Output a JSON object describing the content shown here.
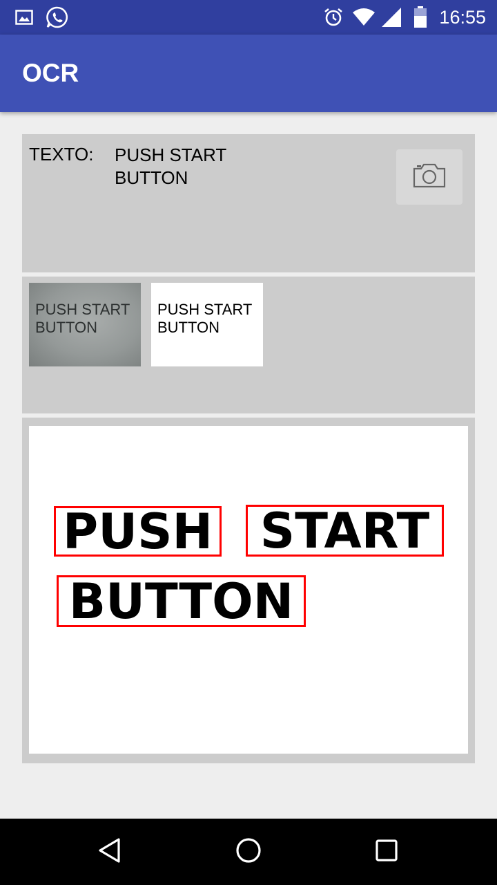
{
  "status_bar": {
    "time": "16:55",
    "left_icons": [
      "gallery-icon",
      "whatsapp-icon"
    ],
    "right_icons": [
      "alarm-icon",
      "wifi-icon",
      "signal-icon",
      "battery-icon"
    ]
  },
  "app_bar": {
    "title": "OCR"
  },
  "text_panel": {
    "label": "TEXTO:",
    "value_line1": "PUSH START",
    "value_line2": "BUTTON",
    "camera_icon": "camera-icon"
  },
  "thumbnails": {
    "original_line1": "PUSH START",
    "original_line2": "BUTTON",
    "processed_line1": "PUSH START",
    "processed_line2": "BUTTON"
  },
  "result": {
    "words": [
      "PUSH",
      "START",
      "BUTTON"
    ],
    "box_color": "#ff0000"
  },
  "nav_bar": {
    "icons": [
      "back-icon",
      "home-icon",
      "recents-icon"
    ]
  },
  "colors": {
    "status_bar": "#303f9f",
    "app_bar": "#3f51b5",
    "panel": "#cccccc",
    "background": "#eeeeee"
  }
}
